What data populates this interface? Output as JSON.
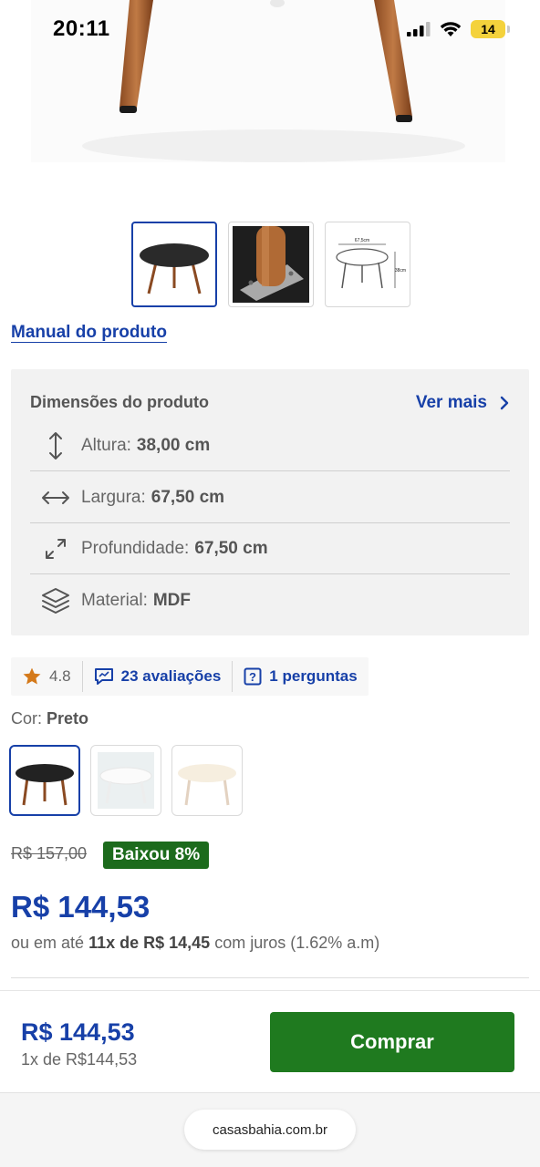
{
  "status_bar": {
    "time": "20:11",
    "battery": "14"
  },
  "gallery": {
    "thumb_dimension_width": "67,5cm",
    "thumb_dimension_height": "38cm"
  },
  "manual_link": "Manual do produto",
  "dimensions": {
    "title": "Dimensões do produto",
    "more": "Ver mais",
    "rows": [
      {
        "label": "Altura:",
        "value": "38,00 cm",
        "icon": "vertical-arrows-icon"
      },
      {
        "label": "Largura:",
        "value": "67,50 cm",
        "icon": "horizontal-arrows-icon"
      },
      {
        "label": "Profundidade:",
        "value": "67,50 cm",
        "icon": "diagonal-expand-icon"
      },
      {
        "label": "Material:",
        "value": "MDF",
        "icon": "layers-icon"
      }
    ]
  },
  "rating": {
    "score": "4.8",
    "reviews": "23 avaliações",
    "questions": "1 perguntas"
  },
  "color": {
    "label": "Cor:",
    "value": "Preto"
  },
  "pricing": {
    "old_price": "R$ 157,00",
    "discount": "Baixou 8%",
    "price": "R$ 144,53",
    "installments_prefix": "ou em até",
    "installments_bold": "11x de R$ 14,45",
    "installments_suffix": "com juros (1.62% a.m)"
  },
  "footer": {
    "price": "R$ 144,53",
    "sub": "1x de R$144,53",
    "buy": "Comprar"
  },
  "browser": {
    "url": "casasbahia.com.br"
  },
  "colors": {
    "accent": "#1740a8",
    "buy_green": "#1f7a1f",
    "badge_green": "#1c6b1c",
    "star": "#d4791a"
  }
}
